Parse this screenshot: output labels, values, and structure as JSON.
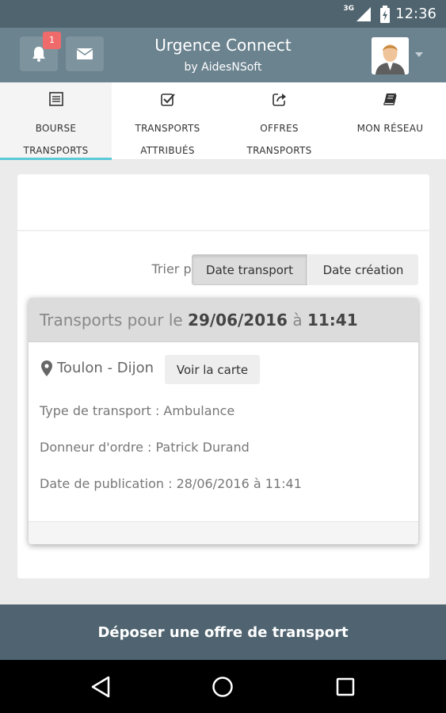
{
  "status_bar": {
    "network": "3G",
    "time": "12:36"
  },
  "app_bar": {
    "title": "Urgence Connect",
    "subtitle": "by AidesNSoft",
    "notification_count": "1"
  },
  "tabs": [
    {
      "line1": "BOURSE",
      "line2": "TRANSPORTS",
      "icon": "list-icon"
    },
    {
      "line1": "TRANSPORTS",
      "line2": "ATTRIBUÉS",
      "icon": "check-icon"
    },
    {
      "line1": "OFFRES",
      "line2": "TRANSPORTS",
      "icon": "share-icon"
    },
    {
      "line1": "MON RÉSEAU",
      "line2": "",
      "icon": "book-icon"
    }
  ],
  "sort": {
    "label": "Trier par",
    "options": [
      "Date transport",
      "Date création"
    ],
    "selected": "Date transport"
  },
  "transport": {
    "header_prefix": "Transports pour le ",
    "date": "29/06/2016",
    "at": " à ",
    "time": "11:41",
    "route": "Toulon - Dijon",
    "map_button": "Voir la carte",
    "type": "Type de transport : Ambulance",
    "client": "Donneur d'ordre : Patrick Durand",
    "published": "Date de publication : 28/06/2016 à 11:41"
  },
  "cta": {
    "label": "Déposer une offre de transport"
  },
  "colors": {
    "primary": "#6b838f",
    "status": "#4f646f",
    "accent": "#5bc9d8",
    "badge": "#ef6b6b"
  }
}
